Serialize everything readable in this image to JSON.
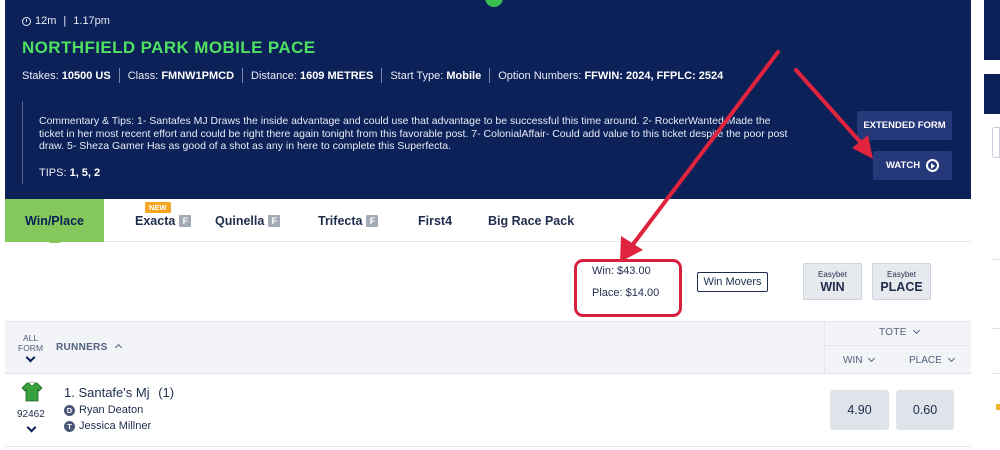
{
  "race": {
    "time_to_go": "12m",
    "time_sep": "|",
    "start_time": "1.17pm",
    "title": "NORTHFIELD PARK MOBILE PACE",
    "details": [
      {
        "label": "Stakes:",
        "value": "10500 US"
      },
      {
        "label": "Class:",
        "value": "FMNW1PMCD"
      },
      {
        "label": "Distance:",
        "value": "1609 METRES"
      },
      {
        "label": "Start Type:",
        "value": "Mobile"
      },
      {
        "label": "Option Numbers:",
        "value": "FFWIN: 2024, FFPLC: 2524"
      }
    ],
    "commentary": "Commentary & Tips:  1- Santafes MJ Draws the inside advantage and could use that advantage to be successful this time around. 2- RockerWanted Made the ticket in her most recent effort and could be right there again tonight from this favorable post. 7- ColonialAffair- Could add value to this ticket despite the poor post draw. 5- Sheza Gamer Has as good of a shot as any in here to complete this Superfecta.",
    "tips_label": "TIPS:",
    "tips_value": "1, 5, 2"
  },
  "buttons": {
    "extended_form": "EXTENDED FORM",
    "watch": "WATCH"
  },
  "tabs": [
    {
      "label": "Win/Place",
      "has_f": false
    },
    {
      "label": "Exacta",
      "has_f": true
    },
    {
      "label": "Quinella",
      "has_f": true
    },
    {
      "label": "Trifecta",
      "has_f": true
    },
    {
      "label": "First4",
      "has_f": false
    },
    {
      "label": "Big Race Pack",
      "has_f": false
    }
  ],
  "tab_f_glyph": "F",
  "new_badge": "NEW",
  "pool": {
    "win": "Win: $43.00",
    "place": "Place: $14.00"
  },
  "win_movers": "Win Movers",
  "easybet_win": {
    "small": "Easybet",
    "large": "WIN"
  },
  "easybet_place": {
    "small": "Easybet",
    "large": "PLACE"
  },
  "table_header": {
    "all_form_1": "ALL",
    "all_form_2": "FORM",
    "runners": "RUNNERS",
    "tote": "TOTE",
    "win": "WIN",
    "place": "PLACE"
  },
  "runners": [
    {
      "id": "92462",
      "name": "1. Santafe's Mj",
      "barrier": "(1)",
      "driver_badge": "D",
      "driver": "Ryan Deaton",
      "trainer_badge": "T",
      "trainer": "Jessica Millner",
      "win": "4.90",
      "place": "0.60"
    }
  ],
  "colors": {
    "header_bg": "#0c2158",
    "title_green": "#4fe062",
    "tab_active": "#84c75b",
    "highlight_red": "#d8203f",
    "arrow_red": "#e0233f"
  },
  "icons": [
    "clock-icon",
    "play-circle-icon",
    "chevron-down-icon",
    "chevron-up-icon",
    "silk-icon"
  ]
}
